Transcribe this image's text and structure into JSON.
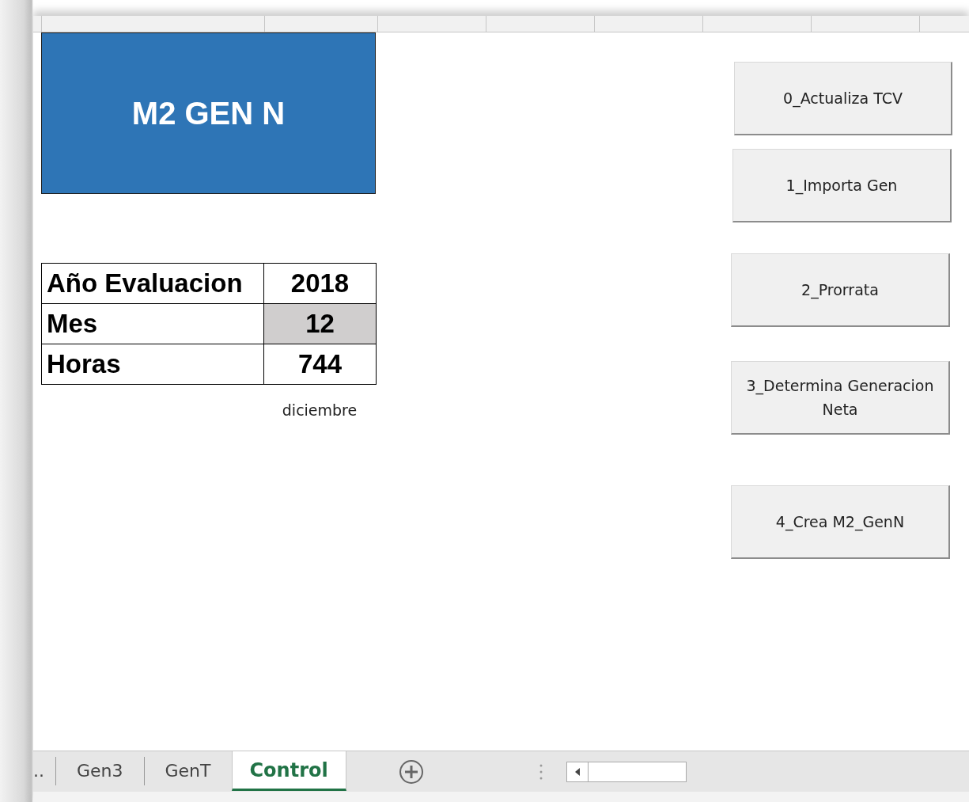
{
  "title_block": {
    "text": "M2 GEN N"
  },
  "parameters": [
    {
      "label": "Año Evaluacion",
      "value": "2018",
      "highlighted": false
    },
    {
      "label": "Mes",
      "value": "12",
      "highlighted": true
    },
    {
      "label": "Horas",
      "value": "744",
      "highlighted": false
    }
  ],
  "month_name": "diciembre",
  "buttons": [
    {
      "label": "0_Actualiza TCV"
    },
    {
      "label": "1_Importa Gen"
    },
    {
      "label": "2_Prorrata"
    },
    {
      "label": "3_Determina Generacion Neta"
    },
    {
      "label": "4_Crea M2_GenN"
    }
  ],
  "sheet_tabs": [
    {
      "label": "..",
      "selected": false
    },
    {
      "label": "Gen3",
      "selected": false
    },
    {
      "label": "GenT",
      "selected": false
    },
    {
      "label": "Control",
      "selected": true
    }
  ]
}
